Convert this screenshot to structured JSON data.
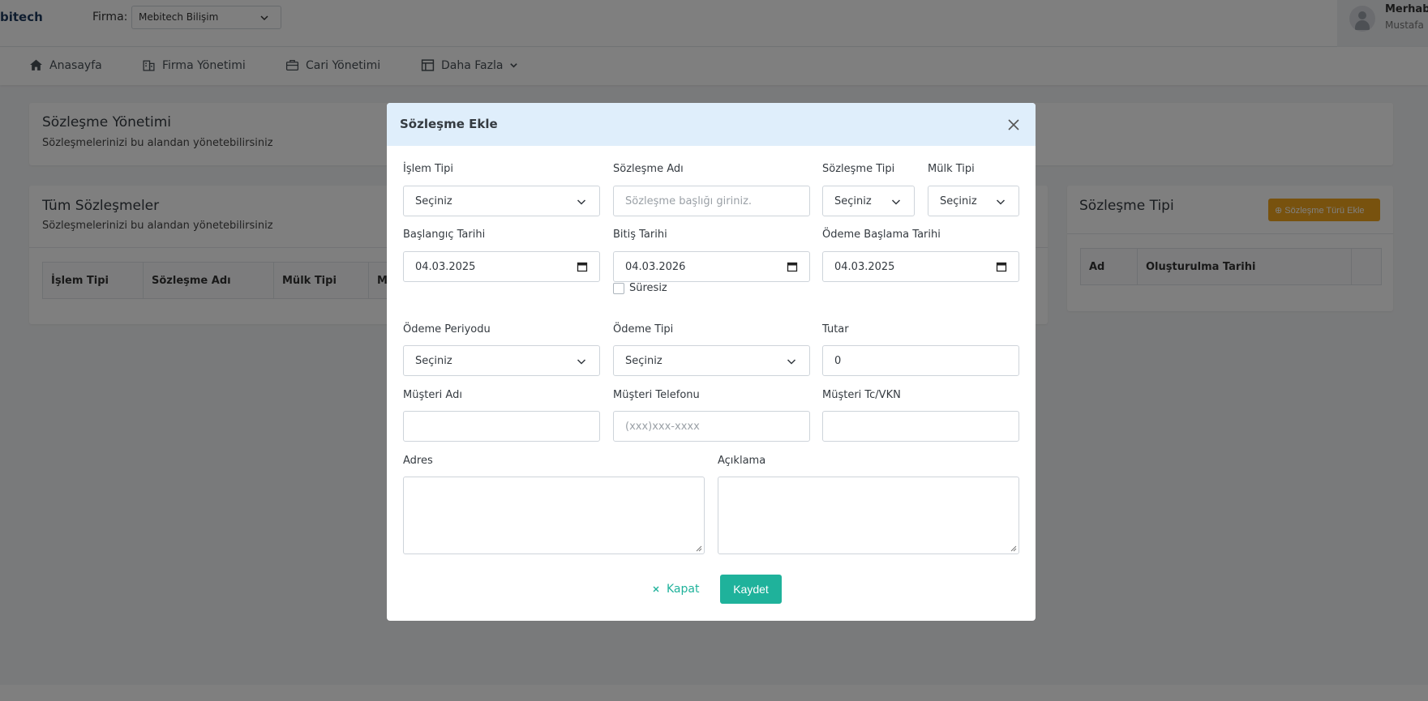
{
  "header": {
    "brand": "bitech",
    "firma_label": "Firma:",
    "firma_value": "Mebitech Bilişim",
    "greeting": "Merhab",
    "user_name": "Mustafa"
  },
  "nav": {
    "items": [
      {
        "label": "Anasayfa",
        "icon": "home-icon"
      },
      {
        "label": "Firma Yönetimi",
        "icon": "building-icon"
      },
      {
        "label": "Cari Yönetimi",
        "icon": "briefcase-icon"
      },
      {
        "label": "Daha Fazla",
        "icon": "table-icon"
      }
    ]
  },
  "page": {
    "mgmt_title": "Sözleşme Yönetimi",
    "mgmt_sub": "Sözleşmelerinizi bu alandan yönetebilirsiniz",
    "all_title": "Tüm Sözleşmeler",
    "all_sub": "Sözleşmelerinizi bu alandan yönetebilirsiniz",
    "all_columns": [
      "İşlem Tipi",
      "Sözleşme Adı",
      "Mülk Tipi",
      "M"
    ],
    "type_title": "Sözleşme Tipi",
    "type_add_button": "⊕ Sözleşme Türü Ekle",
    "type_columns": [
      "Ad",
      "Oluşturulma Tarihi",
      ""
    ]
  },
  "modal": {
    "title": "Sözleşme Ekle",
    "fields": {
      "islem_tipi": {
        "label": "İşlem Tipi",
        "value": "Seçiniz"
      },
      "sozlesme_adi": {
        "label": "Sözleşme Adı",
        "placeholder": "Sözleşme başlığı giriniz."
      },
      "sozlesme_tipi": {
        "label": "Sözleşme Tipi",
        "value": "Seçiniz"
      },
      "mulk_tipi": {
        "label": "Mülk Tipi",
        "value": "Seçiniz"
      },
      "baslangic_tarihi": {
        "label": "Başlangıç Tarihi",
        "value": "04.03.2025"
      },
      "bitis_tarihi": {
        "label": "Bitiş Tarihi",
        "value": "04.03.2026"
      },
      "odeme_baslama_tarihi": {
        "label": "Ödeme Başlama Tarihi",
        "value": "04.03.2025"
      },
      "suresiz": {
        "label": "Süresiz",
        "checked": false
      },
      "odeme_periyodu": {
        "label": "Ödeme Periyodu",
        "value": "Seçiniz"
      },
      "odeme_tipi": {
        "label": "Ödeme Tipi",
        "value": "Seçiniz"
      },
      "tutar": {
        "label": "Tutar",
        "value": "0"
      },
      "musteri_adi": {
        "label": "Müşteri Adı",
        "value": ""
      },
      "musteri_telefonu": {
        "label": "Müşteri Telefonu",
        "placeholder": "(xxx)xxx-xxxx"
      },
      "musteri_tc": {
        "label": "Müşteri Tc/VKN",
        "value": ""
      },
      "adres": {
        "label": "Adres",
        "value": ""
      },
      "aciklama": {
        "label": "Açıklama",
        "value": ""
      }
    },
    "cancel_label": "Kapat",
    "save_label": "Kaydet"
  },
  "colors": {
    "accent": "#1fb29b",
    "warning": "#f0a41c",
    "modal_header": "#dfeefb"
  }
}
